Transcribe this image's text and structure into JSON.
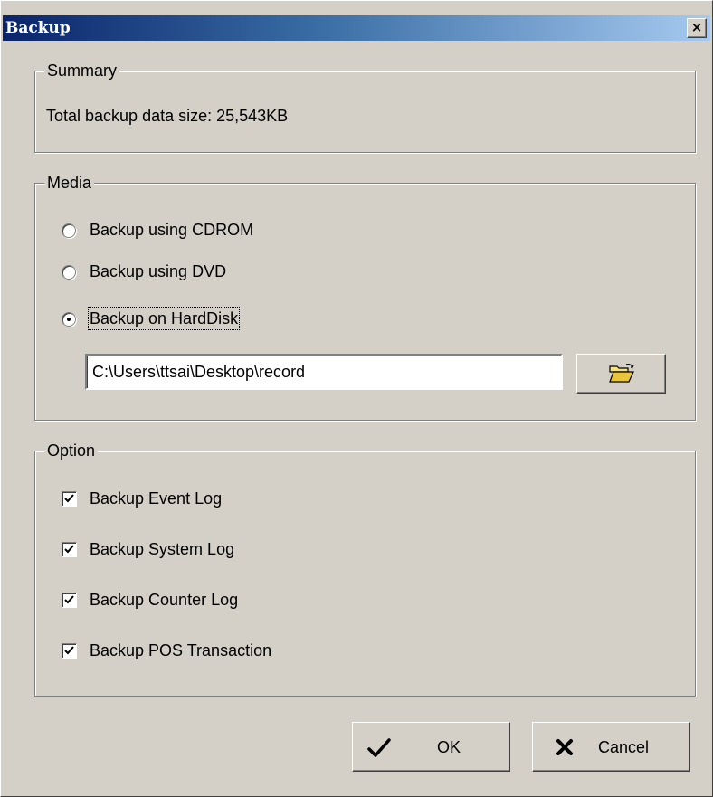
{
  "window": {
    "title": "Backup",
    "close_glyph": "×"
  },
  "summary": {
    "legend": "Summary",
    "total_size_text": "Total backup data size: 25,543KB"
  },
  "media": {
    "legend": "Media",
    "options": [
      {
        "label": "Backup using CDROM",
        "selected": false
      },
      {
        "label": "Backup using DVD",
        "selected": false
      },
      {
        "label": "Backup on HardDisk",
        "selected": true
      }
    ],
    "path_value": "C:\\Users\\ttsai\\Desktop\\record",
    "browse_icon": "folder-open-icon"
  },
  "option": {
    "legend": "Option",
    "items": [
      {
        "label": "Backup Event Log",
        "checked": true
      },
      {
        "label": "Backup System Log",
        "checked": true
      },
      {
        "label": "Backup Counter Log",
        "checked": true
      },
      {
        "label": "Backup POS Transaction",
        "checked": true
      }
    ]
  },
  "buttons": {
    "ok_label": "OK",
    "cancel_label": "Cancel"
  },
  "colors": {
    "face": "#d4d0c8",
    "title_start": "#0a246a",
    "title_end": "#a6caf0"
  }
}
